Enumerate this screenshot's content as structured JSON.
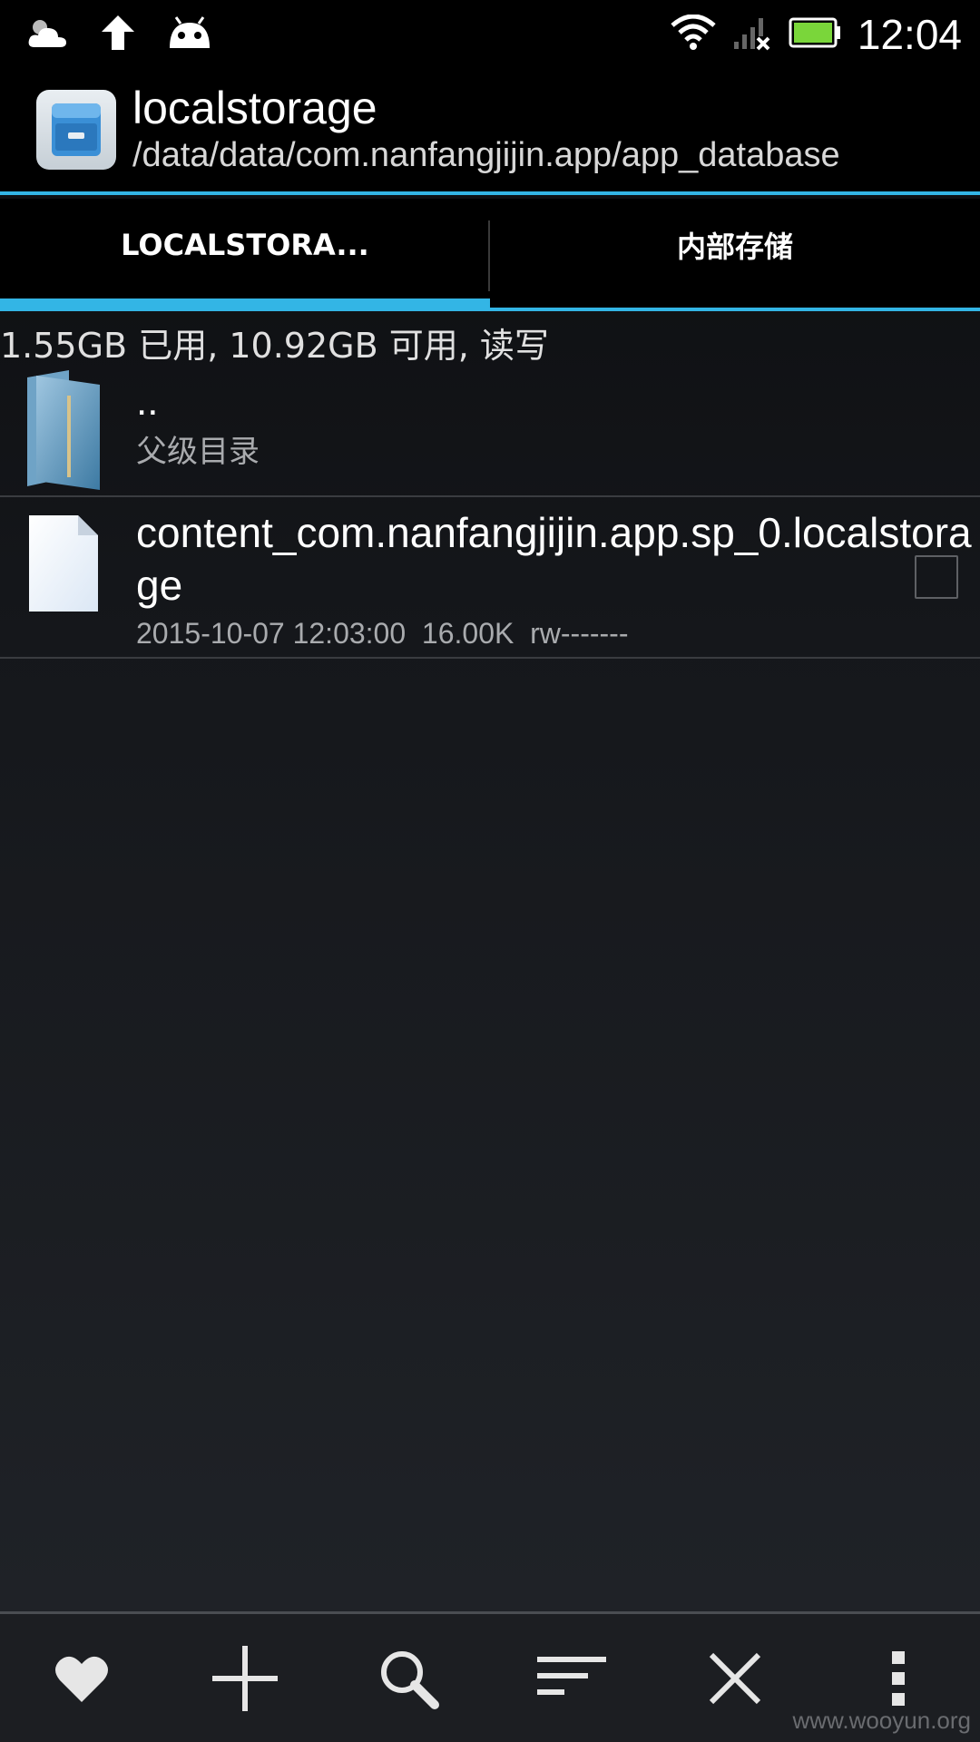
{
  "status_bar": {
    "time": "12:04",
    "icons": [
      "weather-cloud-icon",
      "upload-arrow-icon",
      "android-debug-icon",
      "wifi-icon",
      "signal-icon",
      "battery-icon"
    ],
    "battery_color": "#7ad63a"
  },
  "action_bar": {
    "title": "localstorage",
    "subtitle": "/data/data/com.nanfangjijin.app/app_database",
    "app_icon": "file-cabinet-icon"
  },
  "tabs": [
    {
      "label": "LOCALSTORA...",
      "active": true
    },
    {
      "label": "内部存储",
      "active": false
    }
  ],
  "storage_info": "1.55GB 已用, 10.92GB 可用, 读写",
  "files": {
    "parent": {
      "name": "..",
      "detail": "父级目录",
      "icon": "folder-icon"
    },
    "items": [
      {
        "name": "content_com.nanfangjijin.app.sp_0.localstorage",
        "detail": "2015-10-07 12:03:00  16.00K  rw-------",
        "icon": "file-icon",
        "checked": false
      }
    ]
  },
  "toolbar": {
    "buttons": [
      "favorite-heart-icon",
      "add-plus-icon",
      "search-icon",
      "sort-icon",
      "close-icon",
      "overflow-menu-icon"
    ]
  },
  "watermark": "www.wooyun.org",
  "colors": {
    "accent": "#33b5e5",
    "background_top": "#0b0c0e",
    "background_bottom": "#1f2227"
  }
}
